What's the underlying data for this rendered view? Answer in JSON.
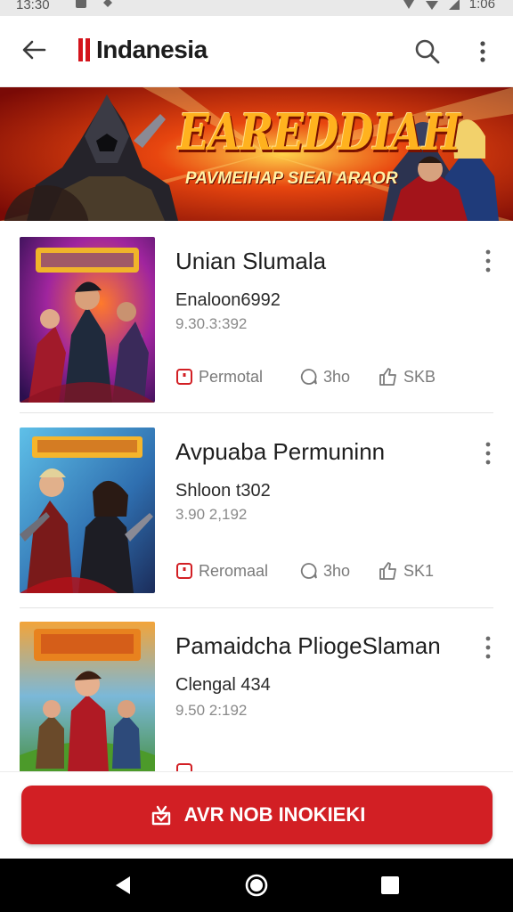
{
  "status": {
    "time": "13:30",
    "right": "1:06"
  },
  "appbar": {
    "title": "Indanesia"
  },
  "banner": {
    "headline": "EAREDDIAH",
    "subline": "PAVMEIHAP SIEAI ARAOR"
  },
  "games": [
    {
      "name": "Unian Slumala",
      "developer": "Enaloon6992",
      "meta": "9.30.3:392",
      "label": "Permotal",
      "comments": "3ho",
      "size": "SKB"
    },
    {
      "name": "Avpuaba Permuninn",
      "developer": "Shloon t302",
      "meta": "3.90 2,192",
      "label": "Reromaal",
      "comments": "3ho",
      "size": "SK1"
    },
    {
      "name": "Pamaidcha PliogeSlaman",
      "developer": "Clengal 434",
      "meta": "9.50 2:192",
      "label": "",
      "comments": "",
      "size": ""
    }
  ],
  "cta": {
    "label": "AVR NOB INOKIEKI"
  },
  "colors": {
    "accent": "#d21f24",
    "banner_bg": "#b5120f",
    "title_gold": "#ffb21e"
  }
}
